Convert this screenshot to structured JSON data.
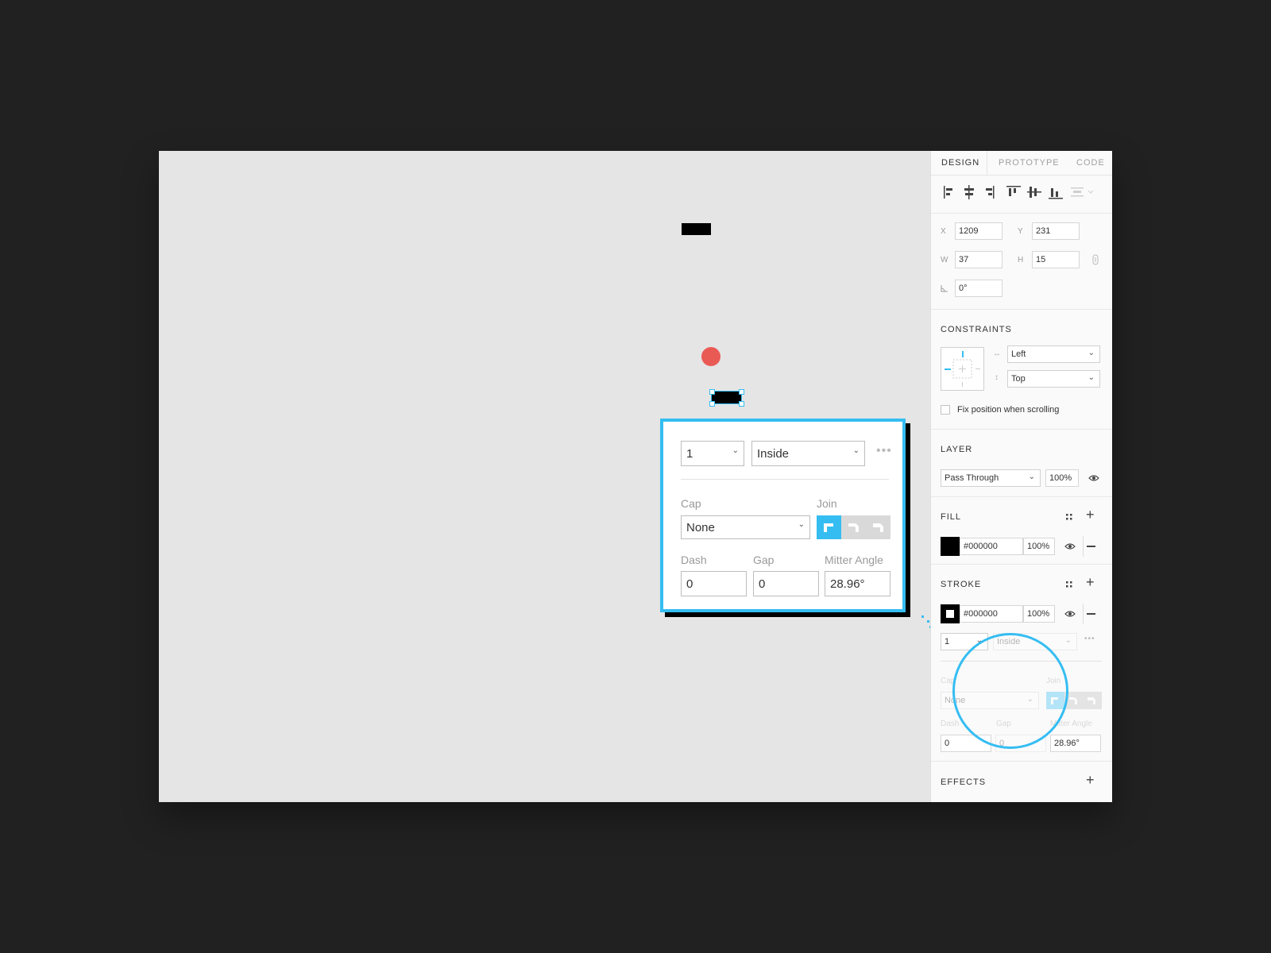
{
  "tabs": [
    {
      "label": "DESIGN",
      "active": true
    },
    {
      "label": "PROTOTYPE",
      "active": false
    },
    {
      "label": "CODE",
      "active": false
    }
  ],
  "align_icons": [
    "align-left-icon",
    "align-center-h-icon",
    "align-right-icon",
    "align-top-icon",
    "align-middle-v-icon",
    "align-bottom-icon",
    "distribute-icon"
  ],
  "geometry": {
    "x_label": "X",
    "x_value": "1209",
    "y_label": "Y",
    "y_value": "231",
    "w_label": "W",
    "w_value": "37",
    "h_label": "H",
    "h_value": "15",
    "rotation_value": "0°"
  },
  "constraints": {
    "title": "CONSTRAINTS",
    "horizontal": "Left",
    "vertical": "Top",
    "fix_label": "Fix position when scrolling"
  },
  "layer": {
    "title": "LAYER",
    "blend": "Pass Through",
    "opacity": "100%"
  },
  "fill": {
    "title": "FILL",
    "hex": "#000000",
    "opacity": "100%",
    "color": "#000000"
  },
  "stroke": {
    "title": "STROKE",
    "hex": "#000000",
    "opacity": "100%",
    "weight": "1",
    "position": "Inside",
    "cap_label": "Cap",
    "cap_value": "None",
    "join_label": "Join",
    "dash_label": "Dash",
    "dash_value": "0",
    "gap_label": "Gap",
    "gap_value": "0",
    "mitter_label": "Mitter Angle",
    "mitter_value": "28.96°"
  },
  "effects": {
    "title": "EFFECTS"
  },
  "popup": {
    "weight": "1",
    "position": "Inside",
    "cap_label": "Cap",
    "cap_value": "None",
    "join_label": "Join",
    "dash_label": "Dash",
    "dash_value": "0",
    "gap_label": "Gap",
    "gap_value": "0",
    "mitter_label": "Mitter Angle",
    "mitter_value": "28.96°"
  },
  "colors": {
    "accent": "#35bdf2",
    "red_dot": "#ea5a55",
    "canvas": "#e5e5e5",
    "background": "#212121"
  }
}
